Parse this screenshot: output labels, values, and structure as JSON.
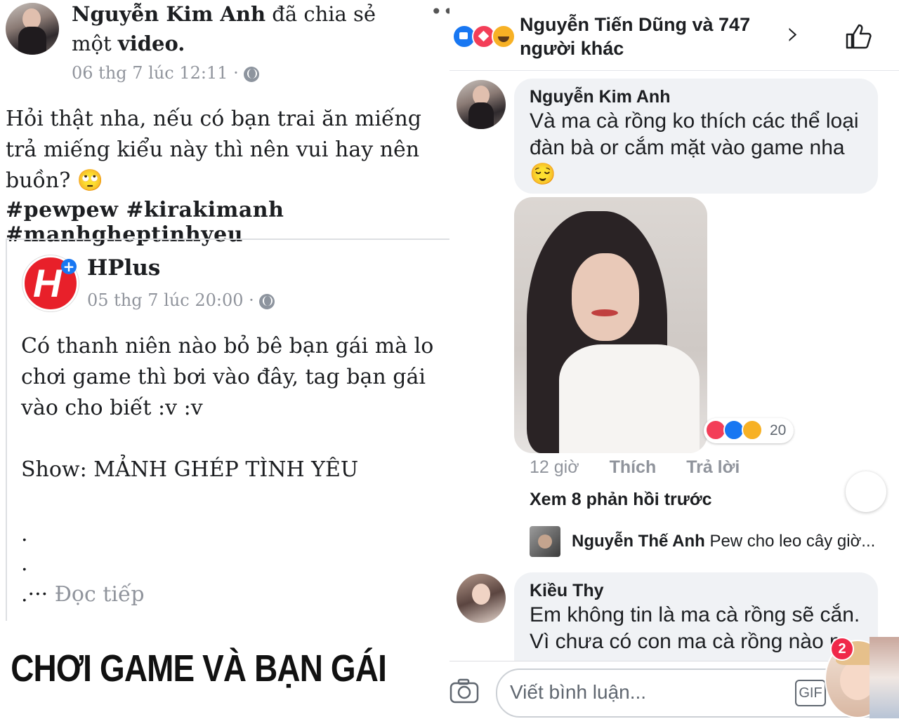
{
  "left_post": {
    "author": "Nguyễn Kim Anh",
    "action": "đã chia sẻ",
    "action2": "một",
    "object": "video.",
    "timestamp": "06 thg 7 lúc 12:11 ·",
    "menu_icon": "more-dots-icon",
    "body": [
      "Hỏi thật nha, nếu có bạn trai ăn miếng",
      "trả miếng kiểu này thì nên vui hay nên",
      "buồn?"
    ],
    "emoji": "🙄",
    "hashtags": "#pewpew #kirakimanh #manhgheptinhyeu"
  },
  "shared_post": {
    "page_name": "HPlus",
    "logo_letter": "H",
    "timestamp": "05 thg 7 lúc 20:00 ·",
    "body": [
      "Có thanh niên nào bỏ bê bạn gái mà lo",
      "chơi game thì bơi vào đây, tag bạn gái",
      "vào cho biết :v :v"
    ],
    "show_line": "Show: MẢNH GHÉP TÌNH YÊU",
    "dot1": ".",
    "dot2": ".",
    "read_more_prefix": ".···",
    "read_more": "Đọc tiếp"
  },
  "banner": {
    "title": "CHƠI GAME VÀ BẠN GÁI"
  },
  "reactions_bar": {
    "text_line1": "Nguyễn Tiến Dũng và 747",
    "text_line2": "người khác",
    "chevron": "›"
  },
  "comments": [
    {
      "author": "Nguyễn Kim Anh",
      "text": [
        "Và ma cà rồng ko thích các thể loại",
        "đàn bà or cắm mặt vào game nha"
      ],
      "emoji": "😌",
      "reaction_count": "20",
      "time": "12 giờ",
      "like_label": "Thích",
      "reply_label": "Trả lời"
    }
  ],
  "replies_link": "Xem 8 phản hồi trước",
  "reply_preview": {
    "author": "Nguyễn Thế Anh",
    "text": "Pew cho leo cây giờ..."
  },
  "comment2": {
    "author": "Kiều Thy",
    "text": [
      "Em không tin là ma cà rồng sẽ cắn.",
      "Vì chưa có con ma cà rồng nào m"
    ]
  },
  "chat_head_badge": "2",
  "composer": {
    "placeholder": "Viết bình luận...",
    "gif_label": "GIF"
  },
  "colors": {
    "like_blue": "#1877f2",
    "love_red": "#f33e58",
    "haha_yellow": "#f7b125",
    "hplus_red": "#e8202a",
    "badge_red": "#f02849"
  }
}
